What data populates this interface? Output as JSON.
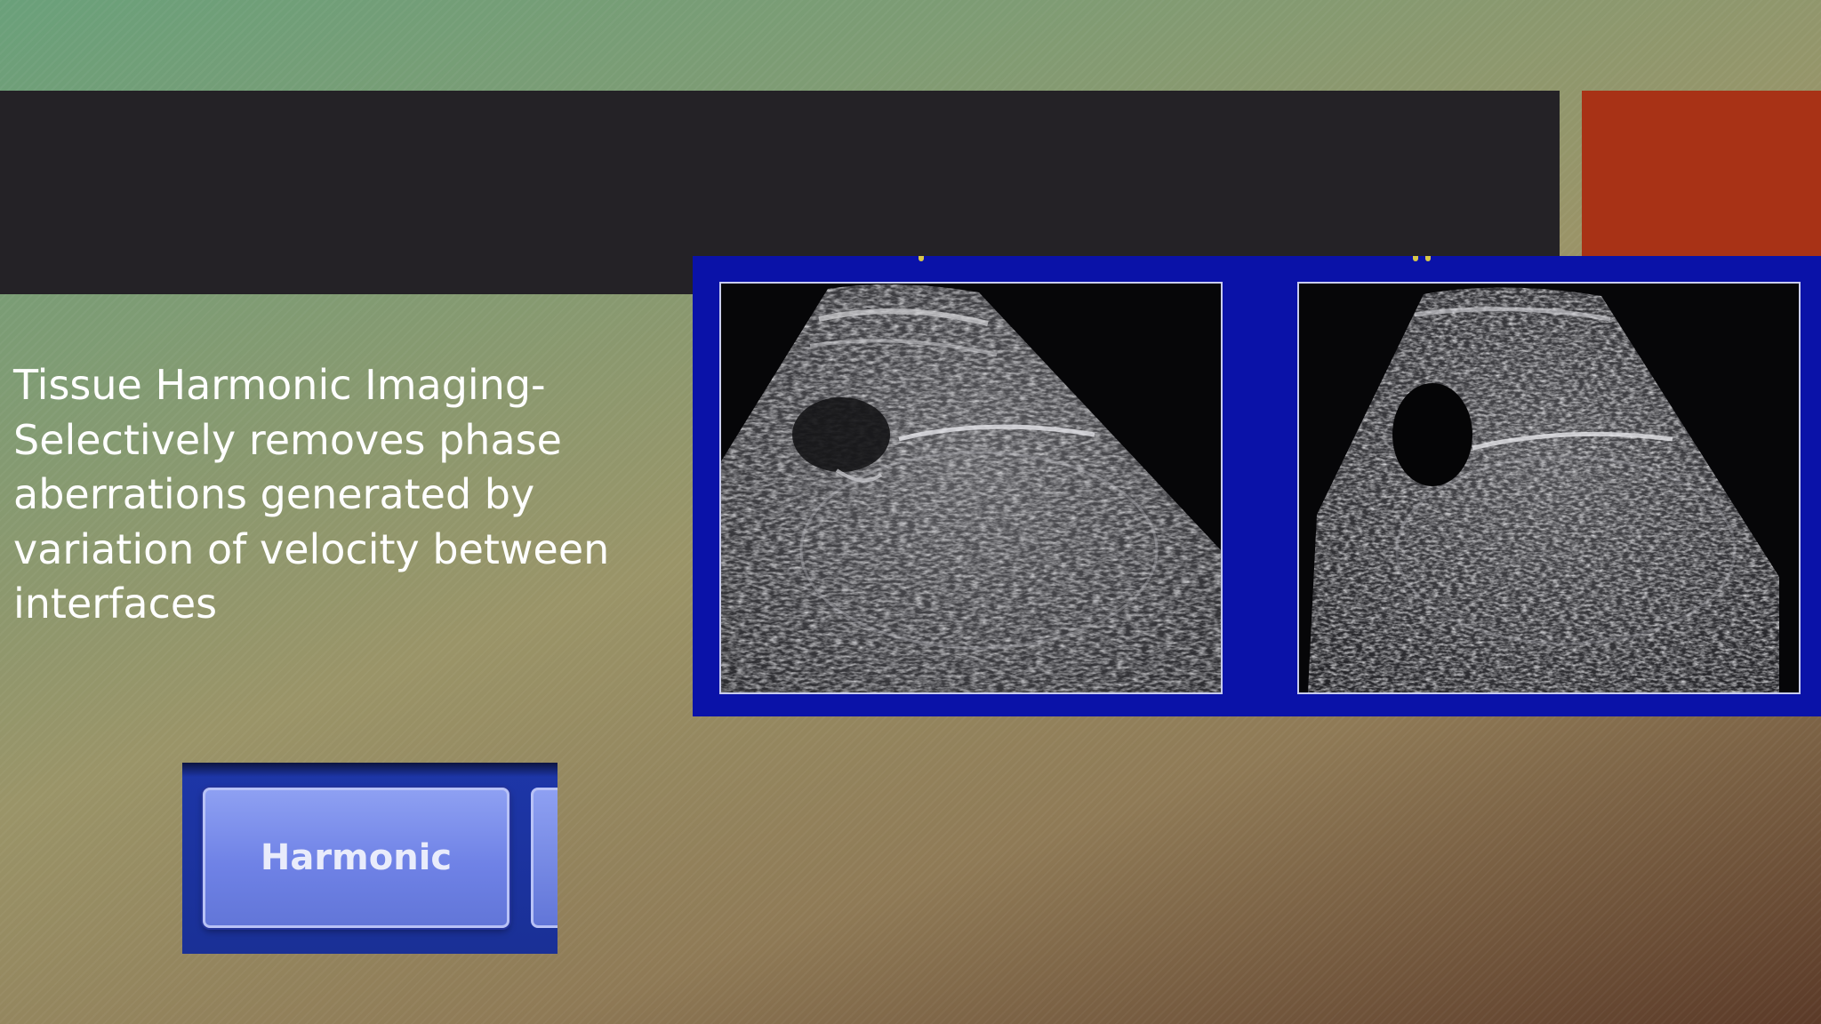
{
  "slide": {
    "body_text": "Tissue Harmonic Imaging-\nSelectively removes phase\naberrations generated by\nvariation of velocity between\ninterfaces",
    "harmonic_button_label": "Harmonic"
  },
  "colors": {
    "title_bar": "#242226",
    "accent_block": "#a83216",
    "ultrasound_panel": "#0a12a8",
    "text": "#ffffff"
  }
}
